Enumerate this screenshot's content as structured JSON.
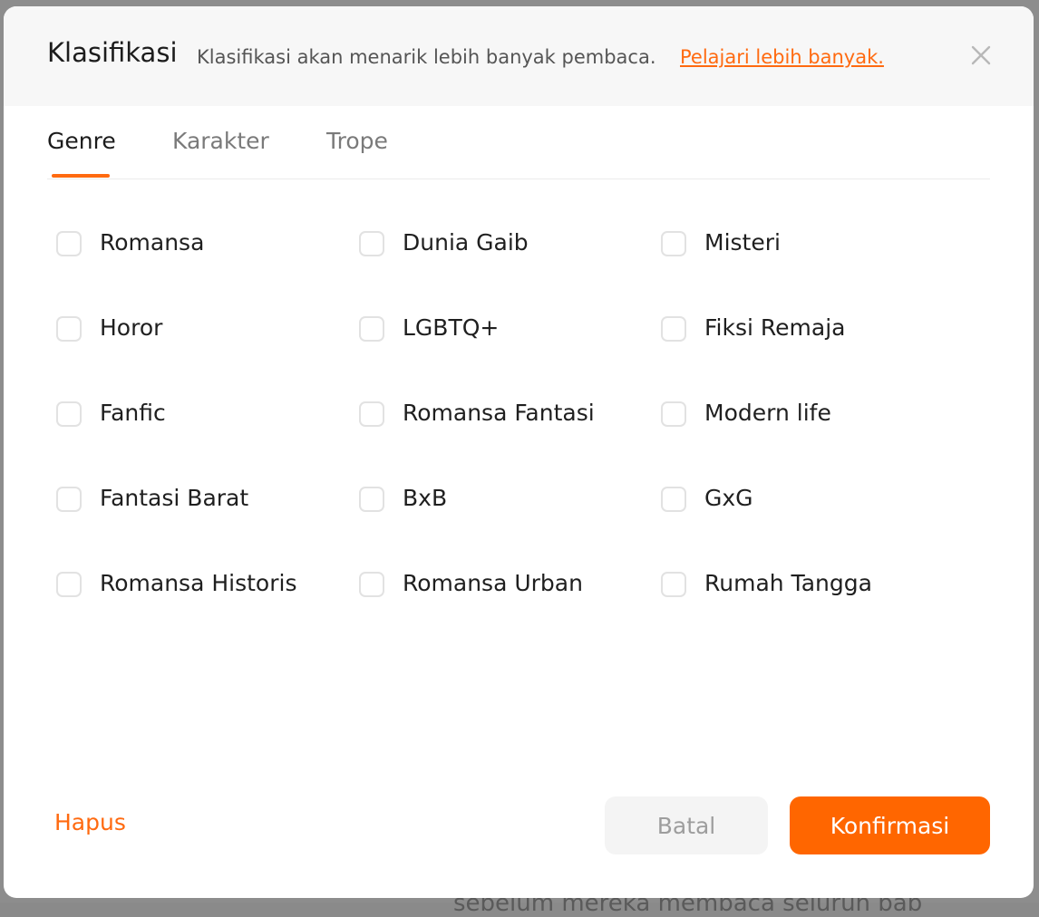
{
  "background": {
    "partial_text": "sebelum mereka membaca seluruh bab"
  },
  "modal": {
    "title": "Klasifikasi",
    "subtitle": "Klasifikasi akan menarik lebih banyak pembaca.",
    "learn_more": "Pelajari lebih banyak."
  },
  "tabs": [
    {
      "label": "Genre",
      "active": true
    },
    {
      "label": "Karakter",
      "active": false
    },
    {
      "label": "Trope",
      "active": false
    }
  ],
  "genres": [
    {
      "label": "Romansa",
      "checked": false
    },
    {
      "label": "Dunia Gaib",
      "checked": false
    },
    {
      "label": "Misteri",
      "checked": false
    },
    {
      "label": "Horor",
      "checked": false
    },
    {
      "label": "LGBTQ+",
      "checked": false
    },
    {
      "label": "Fiksi Remaja",
      "checked": false
    },
    {
      "label": "Fanfic",
      "checked": false
    },
    {
      "label": "Romansa Fantasi",
      "checked": false
    },
    {
      "label": "Modern life",
      "checked": false
    },
    {
      "label": "Fantasi Barat",
      "checked": false
    },
    {
      "label": "BxB",
      "checked": false
    },
    {
      "label": "GxG",
      "checked": false
    },
    {
      "label": "Romansa Historis",
      "checked": false
    },
    {
      "label": "Romansa Urban",
      "checked": false
    },
    {
      "label": "Rumah Tangga",
      "checked": false
    }
  ],
  "footer": {
    "clear_label": "Hapus",
    "cancel_label": "Batal",
    "confirm_label": "Konfirmasi"
  },
  "colors": {
    "accent": "#ff6600",
    "checkbox_border": "#e2e2e2"
  },
  "icons": {
    "close": "close-icon"
  }
}
